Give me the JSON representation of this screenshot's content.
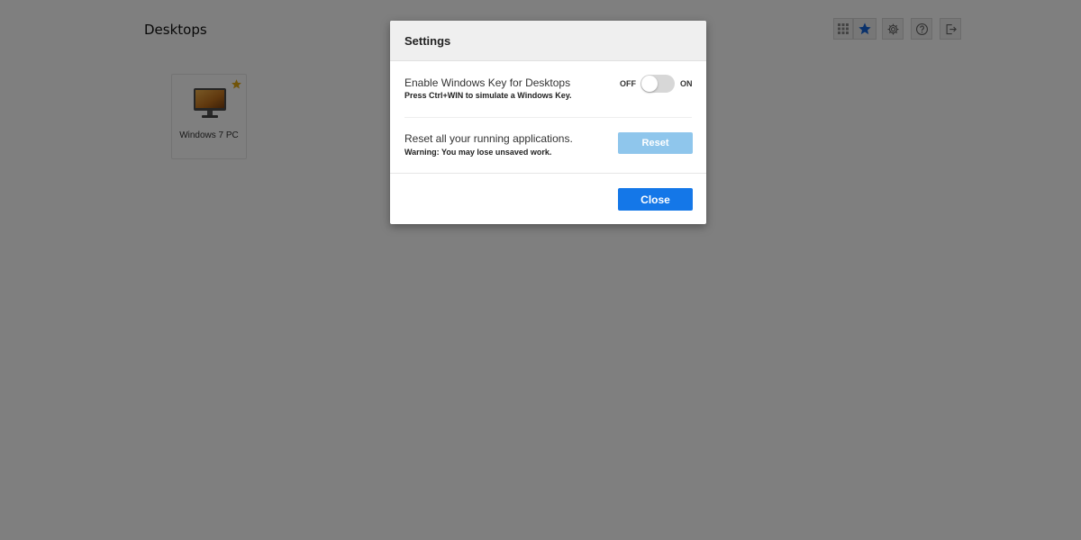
{
  "page": {
    "title": "Desktops"
  },
  "toolbar": {
    "buttons": [
      {
        "name": "grid-view-button",
        "icon": "grid-icon"
      },
      {
        "name": "favorites-button",
        "icon": "star-icon"
      },
      {
        "name": "settings-button",
        "icon": "gear-icon"
      },
      {
        "name": "help-button",
        "icon": "help-icon"
      },
      {
        "name": "logout-button",
        "icon": "logout-icon"
      }
    ]
  },
  "desktops": [
    {
      "label": "Windows 7 PC",
      "favorite": true,
      "icon": "monitor-icon"
    }
  ],
  "settings": {
    "title": "Settings",
    "windows_key": {
      "title": "Enable Windows Key for Desktops",
      "subtitle": "Press Ctrl+WIN to simulate a Windows Key.",
      "off_label": "OFF",
      "on_label": "ON",
      "enabled": false
    },
    "reset": {
      "title": "Reset all your running applications.",
      "subtitle": "Warning: You may lose unsaved work.",
      "button_label": "Reset"
    },
    "close_label": "Close"
  },
  "colors": {
    "accent": "#1477e8",
    "reset_button": "#8fc6ec",
    "favorite_star": "#e3a812",
    "overlay": "rgba(0,0,0,0.5)"
  }
}
